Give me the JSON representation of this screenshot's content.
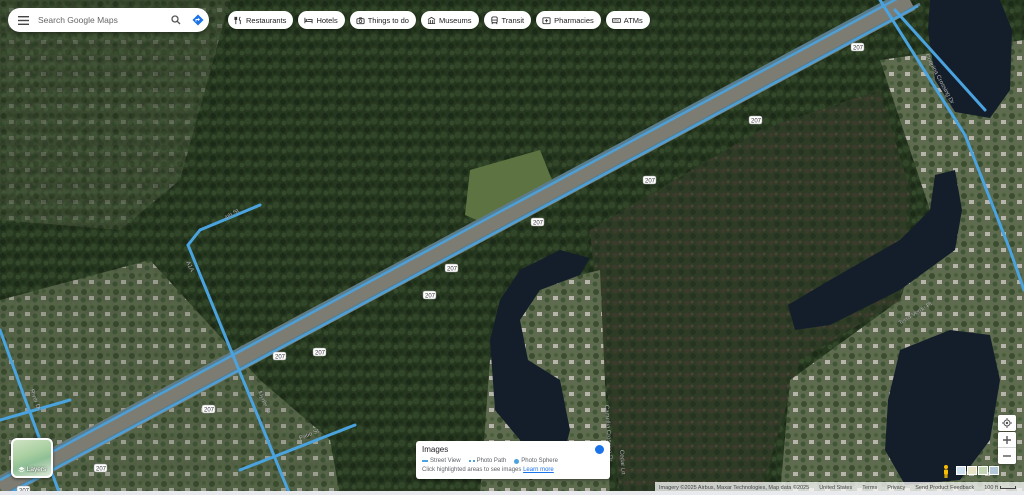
{
  "search": {
    "placeholder": "Search Google Maps"
  },
  "chips": [
    {
      "label": "Restaurants",
      "icon": "restaurant-icon"
    },
    {
      "label": "Hotels",
      "icon": "hotel-icon"
    },
    {
      "label": "Things to do",
      "icon": "camera-icon"
    },
    {
      "label": "Museums",
      "icon": "museum-icon"
    },
    {
      "label": "Transit",
      "icon": "transit-icon"
    },
    {
      "label": "Pharmacies",
      "icon": "pharmacy-icon"
    },
    {
      "label": "ATMs",
      "icon": "atm-icon"
    }
  ],
  "map_labels": {
    "route_207": "207",
    "street_4th": "4th St",
    "street_a1a": "A1A",
    "street_river": "River Dr",
    "street_myrtle": "Myrtle St",
    "street_patio": "Patio St",
    "street_camellia": "Camellia Crossing Dr",
    "street_coquina": "Coquina Crossing Dr",
    "street_vera": "Terra Verde Pl",
    "street_cedar": "Cedar Ln"
  },
  "layers": {
    "label": "Layers"
  },
  "images_panel": {
    "title": "Images",
    "legend": [
      "Street View",
      "Photo Path",
      "Photo Sphere"
    ],
    "hint": "Click highlighted areas to see images",
    "learn_more": "Learn more"
  },
  "bottom_bar": {
    "attribution": "Imagery ©2025 Airbus, Maxar Technologies, Map data ©2025",
    "united_states": "United States",
    "terms": "Terms",
    "privacy": "Privacy",
    "feedback": "Send Product Feedback",
    "scale": "100 ft"
  },
  "colors": {
    "street_view_line": "#4aa3df",
    "accent": "#1a73e8",
    "vegetation": "#2a3b21",
    "water": "#141e2a"
  }
}
